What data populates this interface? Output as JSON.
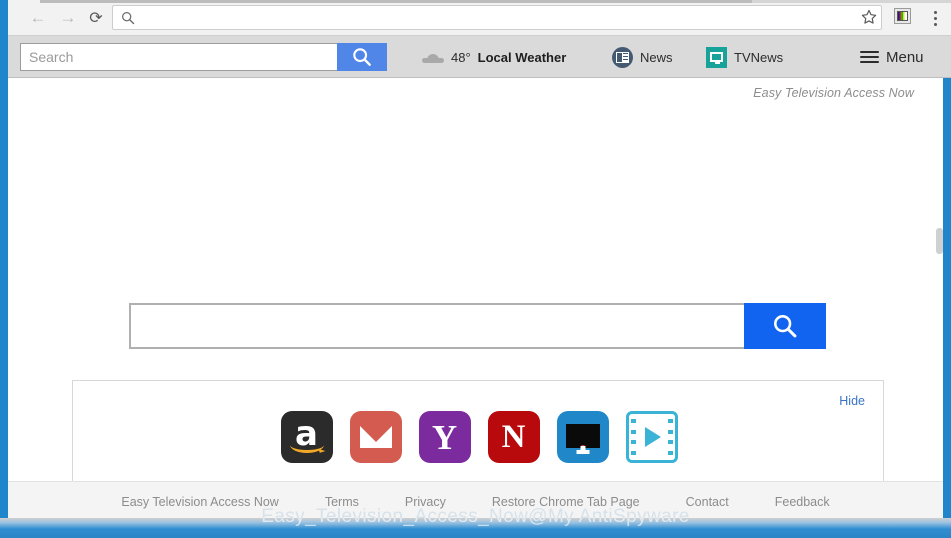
{
  "browser": {
    "back_icon": "back-arrow-icon",
    "forward_icon": "forward-arrow-icon",
    "reload_icon": "reload-icon",
    "address_value": "",
    "address_placeholder": "",
    "bookmark_icon": "star-icon",
    "extension_icon": "tv-extension-icon",
    "menu_icon": "chrome-menu-icon"
  },
  "toolbar": {
    "search_value": "",
    "search_placeholder": "Search",
    "search_button_icon": "search-icon",
    "search_button_color": "#4f86e8",
    "weather": {
      "icon": "cloud-icon",
      "temperature": "48°",
      "label": "Local Weather"
    },
    "news": {
      "icon": "newspaper-icon",
      "label": "News"
    },
    "tvnews": {
      "icon": "tv-monitor-icon",
      "label": "TVNews",
      "icon_color": "#17a39a"
    },
    "menu": {
      "icon": "hamburger-icon",
      "label": "Menu"
    }
  },
  "page": {
    "brand_label": "Easy Television Access Now",
    "search": {
      "value": "",
      "placeholder": "",
      "button_icon": "search-icon",
      "button_color": "#1164f0"
    },
    "shortcuts": {
      "hide_label": "Hide",
      "items": [
        {
          "name": "amazon",
          "glyph": "a",
          "color": "#2b2b2b"
        },
        {
          "name": "mail",
          "glyph": "envelope",
          "color": "#d35b50"
        },
        {
          "name": "yahoo",
          "glyph": "Y",
          "color": "#7b2b9e"
        },
        {
          "name": "netflix",
          "glyph": "N",
          "color": "#b8090d"
        },
        {
          "name": "monitor",
          "glyph": "monitor",
          "color": "#2088c8"
        },
        {
          "name": "video",
          "glyph": "film-play",
          "color": "#3bb3d6"
        }
      ]
    }
  },
  "footer": {
    "links": [
      "Easy Television Access Now",
      "Terms",
      "Privacy",
      "Restore Chrome Tab Page",
      "Contact",
      "Feedback"
    ]
  },
  "watermark": {
    "text": "Easy_Television_Access_Now@My AntiSpyware"
  }
}
